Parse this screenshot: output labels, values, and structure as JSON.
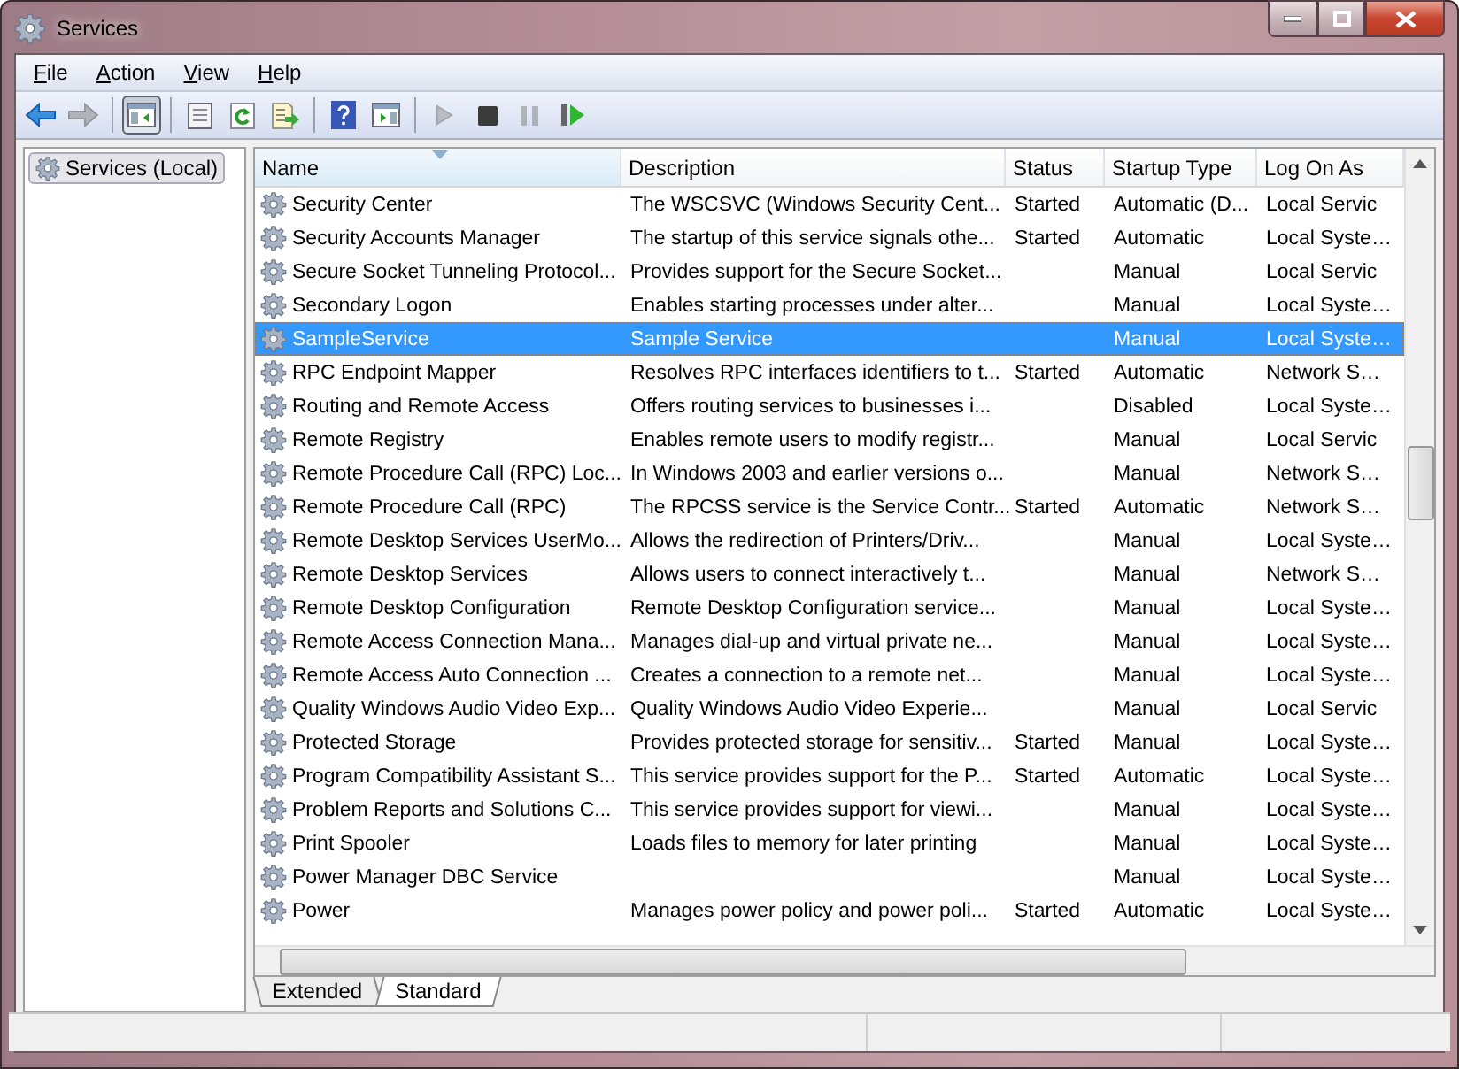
{
  "window": {
    "title": "Services"
  },
  "menu": [
    {
      "label": "File"
    },
    {
      "label": "Action"
    },
    {
      "label": "View"
    },
    {
      "label": "Help"
    }
  ],
  "toolbar": [
    {
      "kind": "back",
      "pressed": false,
      "disabled": false
    },
    {
      "kind": "forward",
      "pressed": false,
      "disabled": true
    },
    {
      "kind": "sep"
    },
    {
      "kind": "tree",
      "pressed": true,
      "disabled": false
    },
    {
      "kind": "sep"
    },
    {
      "kind": "properties",
      "pressed": false,
      "disabled": false
    },
    {
      "kind": "refresh",
      "pressed": false,
      "disabled": false
    },
    {
      "kind": "export",
      "pressed": false,
      "disabled": false
    },
    {
      "kind": "sep"
    },
    {
      "kind": "help",
      "pressed": false,
      "disabled": false
    },
    {
      "kind": "pane",
      "pressed": false,
      "disabled": false
    },
    {
      "kind": "sep"
    },
    {
      "kind": "start",
      "pressed": false,
      "disabled": true
    },
    {
      "kind": "stop",
      "pressed": false,
      "disabled": false
    },
    {
      "kind": "pause",
      "pressed": false,
      "disabled": true
    },
    {
      "kind": "restart",
      "pressed": false,
      "disabled": false
    }
  ],
  "sidebar": {
    "items": [
      {
        "label": "Services (Local)",
        "selected": true
      }
    ]
  },
  "table": {
    "columns": [
      "Name",
      "Description",
      "Status",
      "Startup Type",
      "Log On As"
    ],
    "rows": [
      {
        "name": "Security Center",
        "description": "The WSCSVC (Windows Security Cent...",
        "status": "Started",
        "startup_type": "Automatic (D...",
        "log_on_as": "Local Servic",
        "selected": false
      },
      {
        "name": "Security Accounts Manager",
        "description": "The startup of this service signals othe...",
        "status": "Started",
        "startup_type": "Automatic",
        "log_on_as": "Local Syste…",
        "selected": false
      },
      {
        "name": "Secure Socket Tunneling Protocol...",
        "description": "Provides support for the Secure Socket...",
        "status": "",
        "startup_type": "Manual",
        "log_on_as": "Local Servic",
        "selected": false
      },
      {
        "name": "Secondary Logon",
        "description": "Enables starting processes under alter...",
        "status": "",
        "startup_type": "Manual",
        "log_on_as": "Local Syste…",
        "selected": false
      },
      {
        "name": "SampleService",
        "description": "Sample Service",
        "status": "",
        "startup_type": "Manual",
        "log_on_as": "Local Syste…",
        "selected": true
      },
      {
        "name": "RPC Endpoint Mapper",
        "description": "Resolves RPC interfaces identifiers to t...",
        "status": "Started",
        "startup_type": "Automatic",
        "log_on_as": "Network S…",
        "selected": false
      },
      {
        "name": "Routing and Remote Access",
        "description": "Offers routing services to businesses i...",
        "status": "",
        "startup_type": "Disabled",
        "log_on_as": "Local Syste…",
        "selected": false
      },
      {
        "name": "Remote Registry",
        "description": "Enables remote users to modify registr...",
        "status": "",
        "startup_type": "Manual",
        "log_on_as": "Local Servic",
        "selected": false
      },
      {
        "name": "Remote Procedure Call (RPC) Loc...",
        "description": "In Windows 2003 and earlier versions o...",
        "status": "",
        "startup_type": "Manual",
        "log_on_as": "Network S…",
        "selected": false
      },
      {
        "name": "Remote Procedure Call (RPC)",
        "description": "The RPCSS service is the Service Contr...",
        "status": "Started",
        "startup_type": "Automatic",
        "log_on_as": "Network S…",
        "selected": false
      },
      {
        "name": "Remote Desktop Services UserMo...",
        "description": "Allows the redirection of Printers/Driv...",
        "status": "",
        "startup_type": "Manual",
        "log_on_as": "Local Syste…",
        "selected": false
      },
      {
        "name": "Remote Desktop Services",
        "description": "Allows users to connect interactively t...",
        "status": "",
        "startup_type": "Manual",
        "log_on_as": "Network S…",
        "selected": false
      },
      {
        "name": "Remote Desktop Configuration",
        "description": "Remote Desktop Configuration service...",
        "status": "",
        "startup_type": "Manual",
        "log_on_as": "Local Syste…",
        "selected": false
      },
      {
        "name": "Remote Access Connection Mana...",
        "description": "Manages dial-up and virtual private ne...",
        "status": "",
        "startup_type": "Manual",
        "log_on_as": "Local Syste…",
        "selected": false
      },
      {
        "name": "Remote Access Auto Connection ...",
        "description": "Creates a connection to a remote net...",
        "status": "",
        "startup_type": "Manual",
        "log_on_as": "Local Syste…",
        "selected": false
      },
      {
        "name": "Quality Windows Audio Video Exp...",
        "description": "Quality Windows Audio Video Experie...",
        "status": "",
        "startup_type": "Manual",
        "log_on_as": "Local Servic",
        "selected": false
      },
      {
        "name": "Protected Storage",
        "description": "Provides protected storage for sensitiv...",
        "status": "Started",
        "startup_type": "Manual",
        "log_on_as": "Local Syste…",
        "selected": false
      },
      {
        "name": "Program Compatibility Assistant S...",
        "description": "This service provides support for the P...",
        "status": "Started",
        "startup_type": "Automatic",
        "log_on_as": "Local Syste…",
        "selected": false
      },
      {
        "name": "Problem Reports and Solutions C...",
        "description": "This service provides support for viewi...",
        "status": "",
        "startup_type": "Manual",
        "log_on_as": "Local Syste…",
        "selected": false
      },
      {
        "name": "Print Spooler",
        "description": "Loads files to memory for later printing",
        "status": "",
        "startup_type": "Manual",
        "log_on_as": "Local Syste…",
        "selected": false
      },
      {
        "name": "Power Manager DBC Service",
        "description": "",
        "status": "",
        "startup_type": "Manual",
        "log_on_as": "Local Syste…",
        "selected": false
      },
      {
        "name": "Power",
        "description": "Manages power policy and power poli...",
        "status": "Started",
        "startup_type": "Automatic",
        "log_on_as": "Local Syste…",
        "selected": false
      }
    ]
  },
  "view_tabs": [
    {
      "label": "Extended",
      "selected": false
    },
    {
      "label": "Standard",
      "selected": true
    }
  ]
}
